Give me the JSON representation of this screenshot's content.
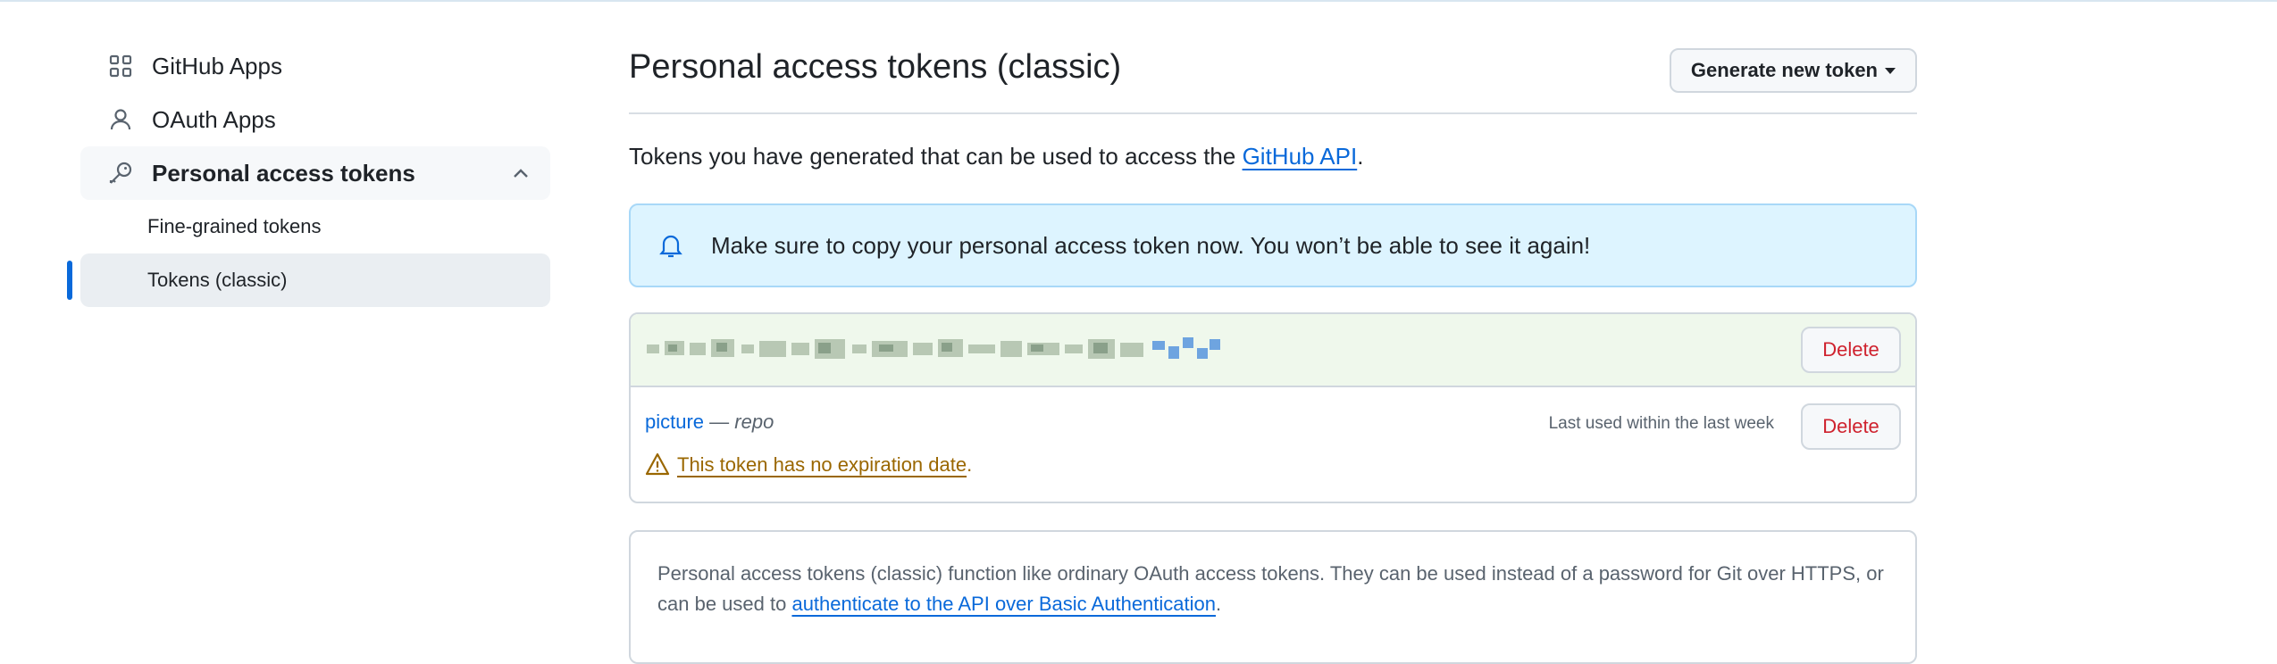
{
  "sidebar": {
    "items": [
      {
        "label": "GitHub Apps",
        "icon": "apps-grid-icon"
      },
      {
        "label": "OAuth Apps",
        "icon": "person-icon"
      },
      {
        "label": "Personal access tokens",
        "icon": "key-icon",
        "expanded": true
      }
    ],
    "sub_items": [
      {
        "label": "Fine-grained tokens",
        "selected": false
      },
      {
        "label": "Tokens (classic)",
        "selected": true
      }
    ]
  },
  "header": {
    "title": "Personal access tokens (classic)",
    "generate_button": "Generate new token"
  },
  "intro": {
    "text": "Tokens you have generated that can be used to access the ",
    "link": "GitHub API",
    "suffix": "."
  },
  "flash": {
    "message": "Make sure to copy your personal access token now. You won’t be able to see it again!"
  },
  "tokens": {
    "new_token": {
      "delete_label": "Delete"
    },
    "list": [
      {
        "name": "picture",
        "separator": " — ",
        "scope": "repo",
        "last_used": "Last used within the last week",
        "warning": "This token has no expiration date",
        "warning_suffix": ".",
        "delete_label": "Delete"
      }
    ]
  },
  "info": {
    "text": "Personal access tokens (classic) function like ordinary OAuth access tokens. They can be used instead of a password for Git over HTTPS, or can be used to ",
    "link": "authenticate to the API over Basic Authentication",
    "suffix": "."
  },
  "colors": {
    "accent": "#0969da",
    "danger": "#cf222e",
    "warning": "#9a6700",
    "flash_bg": "#ddf4ff",
    "success_bg": "#eff8ec"
  }
}
